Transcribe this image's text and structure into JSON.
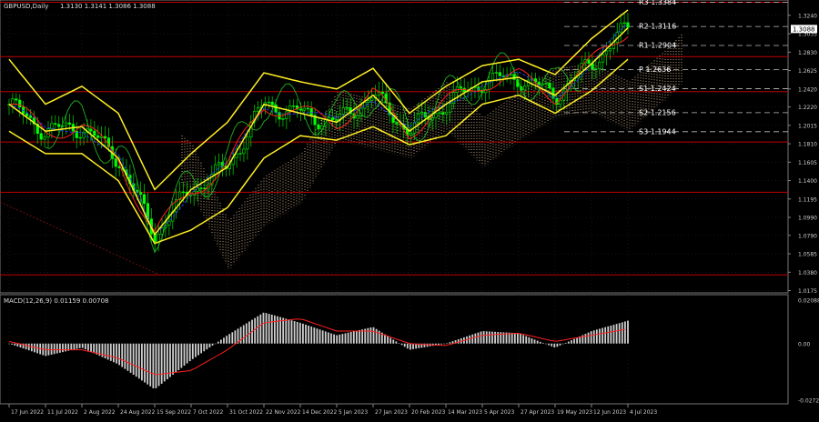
{
  "header": {
    "symbol": "GBPUSD,Daily",
    "ohlc": "1.3130 1.3141 1.3086 1.3088"
  },
  "macd_header": "MACD(12,26,9) 0.01159 0.00708",
  "current_price": "1.3088",
  "price_axis": {
    "labels": [
      "1.3240",
      "1.3035",
      "1.2830",
      "1.2625",
      "1.2420",
      "1.2220",
      "1.2015",
      "1.1810",
      "1.1605",
      "1.1400",
      "1.1195",
      "1.0990",
      "1.0790",
      "1.0585",
      "1.0380",
      "1.0175"
    ],
    "tick_values": [
      1.324,
      1.3035,
      1.283,
      1.2625,
      1.242,
      1.222,
      1.2015,
      1.181,
      1.1605,
      1.14,
      1.1195,
      1.099,
      1.079,
      1.0585,
      1.038,
      1.0175
    ]
  },
  "macd_axis": {
    "labels": [
      "0.02088",
      "0.00",
      "-0.02722"
    ],
    "tick_values": [
      0.02088,
      0.0,
      -0.02722
    ]
  },
  "date_axis": [
    "17 Jun 2022",
    "11 Jul 2022",
    "2 Aug 2022",
    "24 Aug 2022",
    "15 Sep 2022",
    "7 Oct 2022",
    "31 Oct 2022",
    "22 Nov 2022",
    "14 Dec 2022",
    "5 Jan 2023",
    "27 Jan 2023",
    "20 Feb 2023",
    "14 Mar 2023",
    "5 Apr 2023",
    "27 Apr 2023",
    "19 May 2023",
    "12 Jun 2023",
    "4 Jul 2023"
  ],
  "pivots": [
    {
      "label": "R3",
      "value": "1.3384",
      "price": 1.3384
    },
    {
      "label": "R2",
      "value": "1.3116",
      "price": 1.3116
    },
    {
      "label": "R1",
      "value": "1.2904",
      "price": 1.2904
    },
    {
      "label": "P",
      "value": "1.2636",
      "price": 1.2636
    },
    {
      "label": "S1",
      "value": "1.2424",
      "price": 1.2424
    },
    {
      "label": "S2",
      "value": "1.2156",
      "price": 1.2156
    },
    {
      "label": "S3",
      "value": "1.1944",
      "price": 1.1944
    }
  ],
  "red_levels": [
    1.3385,
    1.278,
    1.239,
    1.183,
    1.127,
    1.035
  ],
  "chart_data": {
    "type": "line",
    "title": "GBPUSD,Daily",
    "x": [
      "17 Jun 2022",
      "11 Jul 2022",
      "2 Aug 2022",
      "24 Aug 2022",
      "15 Sep 2022",
      "7 Oct 2022",
      "31 Oct 2022",
      "22 Nov 2022",
      "14 Dec 2022",
      "5 Jan 2023",
      "27 Jan 2023",
      "20 Feb 2023",
      "14 Mar 2023",
      "5 Apr 2023",
      "27 Apr 2023",
      "19 May 2023",
      "12 Jun 2023",
      "4 Jul 2023"
    ],
    "series": [
      {
        "values": [
          1.225,
          1.195,
          1.2,
          1.165,
          1.08,
          1.13,
          1.155,
          1.225,
          1.215,
          1.205,
          1.235,
          1.195,
          1.225,
          1.25,
          1.255,
          1.235,
          1.27,
          1.31
        ]
      },
      {
        "values": [
          1.275,
          1.225,
          1.245,
          1.215,
          1.13,
          1.17,
          1.205,
          1.26,
          1.25,
          1.242,
          1.265,
          1.215,
          1.245,
          1.268,
          1.275,
          1.258,
          1.298,
          1.33
        ]
      },
      {
        "values": [
          1.195,
          1.17,
          1.17,
          1.14,
          1.07,
          1.085,
          1.11,
          1.165,
          1.19,
          1.185,
          1.2,
          1.18,
          1.19,
          1.225,
          1.235,
          1.215,
          1.24,
          1.275
        ]
      }
    ],
    "macd": {
      "histogram": [
        0.0,
        -0.006,
        -0.002,
        -0.01,
        -0.022,
        -0.008,
        0.004,
        0.015,
        0.01,
        0.004,
        0.008,
        -0.003,
        0.0,
        0.006,
        0.005,
        -0.002,
        0.006,
        0.011
      ],
      "signal": [
        0.001,
        -0.003,
        -0.003,
        -0.007,
        -0.015,
        -0.013,
        -0.003,
        0.01,
        0.012,
        0.006,
        0.006,
        0.0,
        -0.001,
        0.004,
        0.005,
        0.001,
        0.004,
        0.007
      ]
    }
  }
}
